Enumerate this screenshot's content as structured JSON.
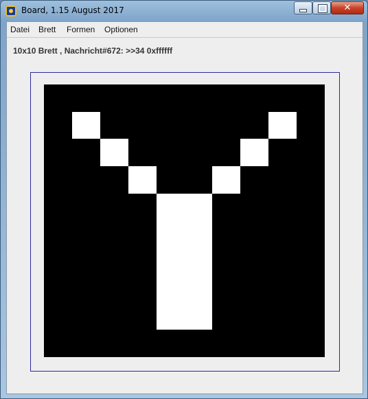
{
  "window": {
    "title": "Board, 1.15 August 2017",
    "close_glyph": "✕"
  },
  "menu": {
    "items": [
      "Datei",
      "Brett",
      "Formen",
      "Optionen"
    ]
  },
  "status": {
    "text": "10x10 Brett , Nachricht#672: >>34 0xffffff"
  },
  "board": {
    "rows": 10,
    "cols": 10,
    "background_color": "#000000",
    "on_color": "#ffffff",
    "cells": [
      [
        0,
        0,
        0,
        0,
        0,
        0,
        0,
        0,
        0,
        0
      ],
      [
        0,
        1,
        0,
        0,
        0,
        0,
        0,
        0,
        1,
        0
      ],
      [
        0,
        0,
        1,
        0,
        0,
        0,
        0,
        1,
        0,
        0
      ],
      [
        0,
        0,
        0,
        1,
        0,
        0,
        1,
        0,
        0,
        0
      ],
      [
        0,
        0,
        0,
        0,
        1,
        1,
        0,
        0,
        0,
        0
      ],
      [
        0,
        0,
        0,
        0,
        1,
        1,
        0,
        0,
        0,
        0
      ],
      [
        0,
        0,
        0,
        0,
        1,
        1,
        0,
        0,
        0,
        0
      ],
      [
        0,
        0,
        0,
        0,
        1,
        1,
        0,
        0,
        0,
        0
      ],
      [
        0,
        0,
        0,
        0,
        1,
        1,
        0,
        0,
        0,
        0
      ],
      [
        0,
        0,
        0,
        0,
        0,
        0,
        0,
        0,
        0,
        0
      ]
    ]
  }
}
